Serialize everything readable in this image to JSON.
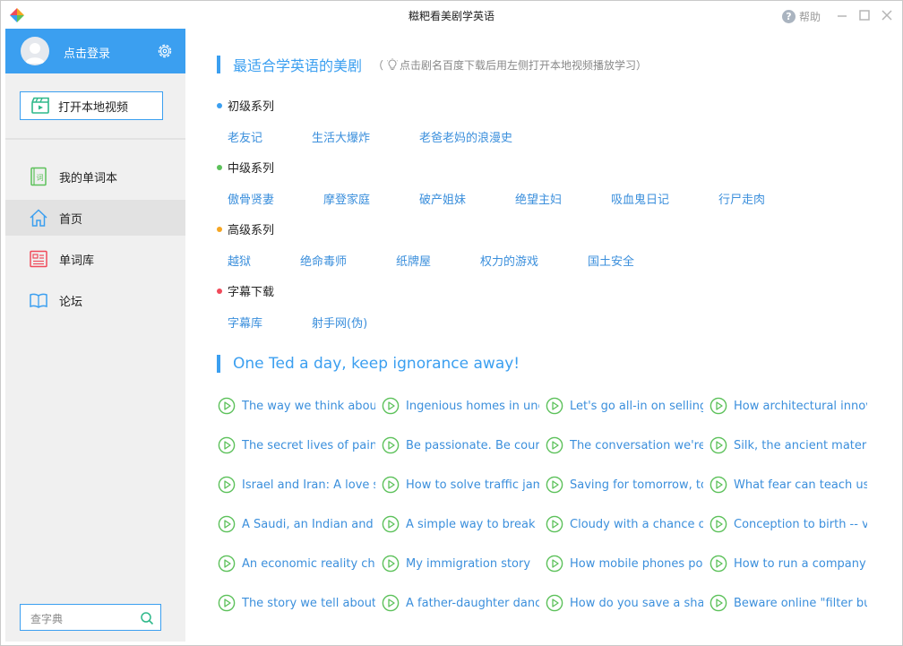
{
  "window": {
    "title": "糍粑看美剧学英语",
    "help_label": "帮助"
  },
  "sidebar": {
    "login_label": "点击登录",
    "open_video_label": "打开本地视频",
    "nav": [
      {
        "label": "我的单词本",
        "icon": "vocabulary-book-icon"
      },
      {
        "label": "首页",
        "icon": "home-icon",
        "active": true
      },
      {
        "label": "单词库",
        "icon": "word-library-icon"
      },
      {
        "label": "论坛",
        "icon": "forum-book-icon"
      }
    ],
    "search_placeholder": "查字典"
  },
  "main": {
    "drama_section": {
      "title": "最适合学英语的美剧",
      "hint_open": "（",
      "hint": "点击剧名百度下载后用左侧打开本地视频播放学习",
      "hint_close": "）"
    },
    "series": [
      {
        "title": "初级系列",
        "dot_color": "#3b9ff0",
        "shows": [
          "老友记",
          "生活大爆炸",
          "老爸老妈的浪漫史"
        ]
      },
      {
        "title": "中级系列",
        "dot_color": "#5cc15a",
        "shows": [
          "傲骨贤妻",
          "摩登家庭",
          "破产姐妹",
          "绝望主妇",
          "吸血鬼日记",
          "行尸走肉"
        ]
      },
      {
        "title": "高级系列",
        "dot_color": "#f5a623",
        "shows": [
          "越狱",
          "绝命毒师",
          "纸牌屋",
          "权力的游戏",
          "国土安全"
        ]
      },
      {
        "title": "字幕下载",
        "dot_color": "#f04a5a",
        "shows": [
          "字幕库",
          "射手网(伪)"
        ]
      }
    ],
    "ted_section": {
      "title": "One Ted a day, keep ignorance away!",
      "talks": [
        [
          "The way we think about",
          "Ingenious homes in une:",
          "Let's go all-in on selling",
          "How architectural innova"
        ],
        [
          "The secret lives of painti",
          "Be passionate. Be courag",
          "The conversation we're r",
          "Silk, the ancient material"
        ],
        [
          "Israel and Iran: A love sto",
          "How to solve traffic jams",
          "Saving for tomorrow, to",
          "What fear can teach us"
        ],
        [
          "A Saudi, an Indian and a",
          "A simple way to break a",
          "Cloudy with a chance of",
          "Conception to birth -- vi"
        ],
        [
          "An economic reality che",
          "My immigration story",
          "How mobile phones pow",
          "How to run a company v"
        ],
        [
          "The story we tell about p",
          "A father-daughter dance",
          "How do you save a shark",
          "Beware online \"filter bub"
        ]
      ]
    }
  },
  "colors": {
    "accent": "#3b9ff0",
    "link": "#3b8fdc",
    "play_icon": "#5cc15a",
    "sidebar_bg": "#f0f0f0"
  }
}
